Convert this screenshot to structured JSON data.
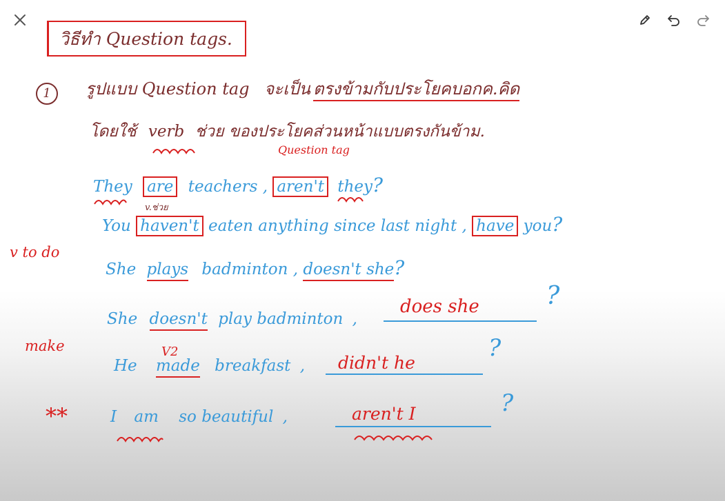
{
  "toolbar": {
    "close_icon": "close-icon",
    "edit_icon": "pencil-icon",
    "undo_icon": "undo-icon",
    "redo_icon": "redo-icon"
  },
  "title": "วิธีทำ Question tags.",
  "rule1": {
    "number": "1",
    "line1_a": "รูปแบบ Question tag",
    "line1_b": "จะเป็น",
    "line1_c": "ตรงข้ามกับประโยคบอกค.คิด",
    "line2_a": "โดยใช้",
    "line2_b": "verb",
    "line2_c": "ช่วย ของประโยคส่วนหน้าแบบตรงกันข้าม.",
    "question_tag_label": "Question tag"
  },
  "examples": {
    "e1": {
      "subject": "They",
      "aux": "are",
      "rest": "teachers",
      "comma": ",",
      "tag_aux": "aren't",
      "tag_subj": "they",
      "q": "?",
      "aux_note": "v.ช่วย"
    },
    "e2": {
      "subject": "You",
      "aux": "haven't",
      "rest": "eaten anything since last night",
      "comma": ",",
      "tag_aux": "have",
      "tag_subj": "you",
      "q": "?"
    },
    "e3": {
      "subject": "She",
      "verb": "plays",
      "rest": "badminton",
      "comma": ",",
      "tag": "doesn't she",
      "q": "?"
    },
    "e4": {
      "subject": "She",
      "aux": "doesn't",
      "rest": "play badminton",
      "comma": ",",
      "tag": "does she",
      "q": "?"
    },
    "e5": {
      "subject": "He",
      "verb": "made",
      "rest": "breakfast",
      "comma": ",",
      "tag": "didn't he",
      "q": "?",
      "verb_note": "V2"
    },
    "e6": {
      "subject": "I",
      "verb": "am",
      "rest": "so beautiful",
      "comma": ",",
      "tag": "aren't I",
      "q": "?"
    }
  },
  "margin_notes": {
    "v_to_do": "v to do",
    "make": "make",
    "stars": "**"
  },
  "colors": {
    "red": "#d92020",
    "blue": "#3a9ad9",
    "maroon": "#7b2d2d"
  }
}
